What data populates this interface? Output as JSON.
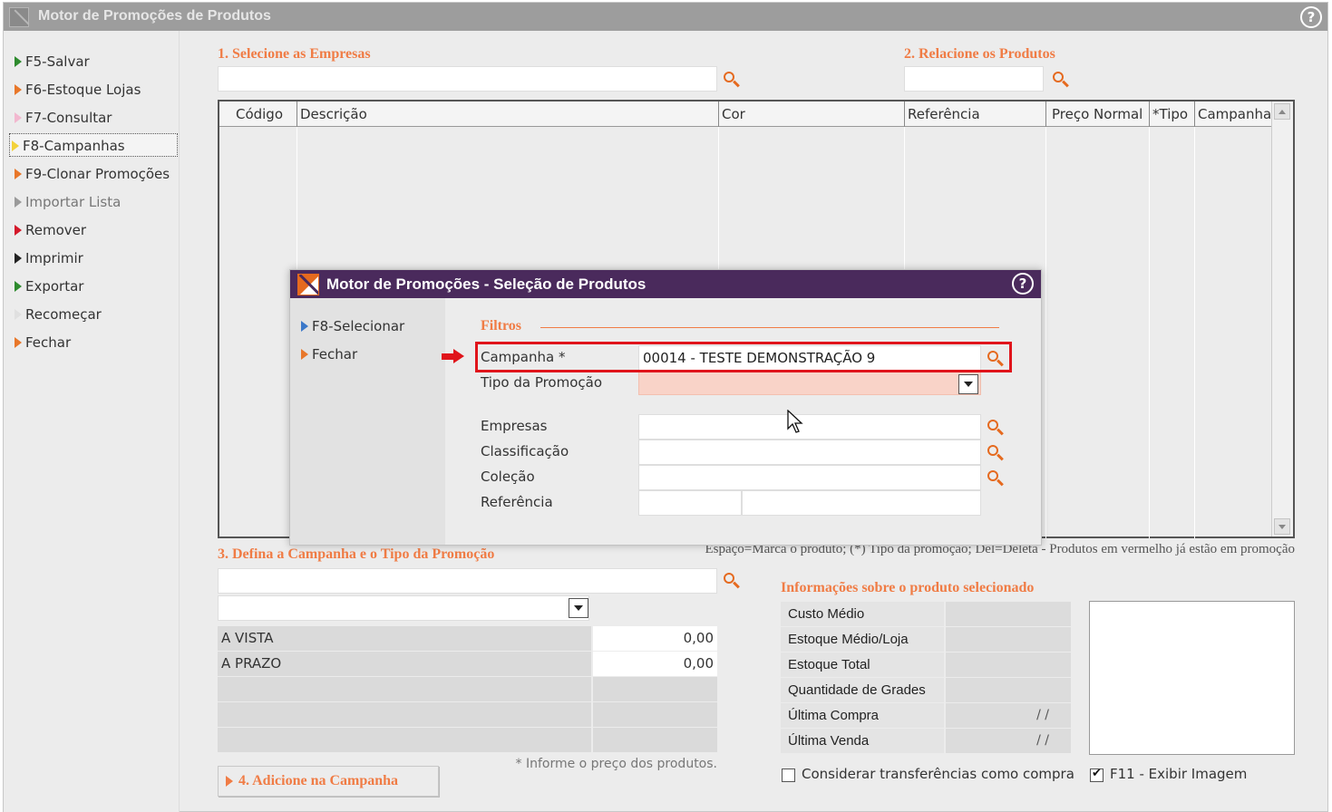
{
  "window": {
    "title": "Motor de Promoções de Produtos"
  },
  "sidebar": {
    "items": [
      {
        "label": "F5-Salvar",
        "color": "#2e8b2e"
      },
      {
        "label": "F6-Estoque Lojas",
        "color": "#e8772a"
      },
      {
        "label": "F7-Consultar",
        "color": "#f2b8cf"
      },
      {
        "label": "F8-Campanhas",
        "color": "#f3d23a"
      },
      {
        "label": "F9-Clonar Promoções",
        "color": "#e8772a"
      },
      {
        "label": "Importar Lista",
        "color": "#9a9a9a"
      },
      {
        "label": "Remover",
        "color": "#d4192b"
      },
      {
        "label": "Imprimir",
        "color": "#222222"
      },
      {
        "label": "Exportar",
        "color": "#2e8b2e"
      },
      {
        "label": "Recomeçar",
        "color": "#e0e0e0"
      },
      {
        "label": "Fechar",
        "color": "#e8772a"
      }
    ]
  },
  "section1": {
    "title": "1. Selecione as Empresas",
    "value": ""
  },
  "section2": {
    "title": "2. Relacione os Produtos",
    "value": ""
  },
  "grid": {
    "columns": [
      "Código",
      "Descrição",
      "Cor",
      "Referência",
      "Preço Normal",
      "*Tipo",
      "Campanha"
    ]
  },
  "legend": {
    "text": "Espaço=Marca o produto; (*) Tipo da promoção; Del=Deleta - Produtos em vermelho já estão em promoção"
  },
  "section3": {
    "title": "3. Defina a Campanha e o Tipo da Promoção",
    "campaign_value": "",
    "type_value": "",
    "prices": [
      {
        "label": "A VISTA",
        "value": "0,00"
      },
      {
        "label": "A PRAZO",
        "value": "0,00"
      }
    ],
    "note": "* Informe o preço dos produtos."
  },
  "section4": {
    "button_label": "4. Adicione na Campanha"
  },
  "info": {
    "title": "Informações sobre o produto selecionado",
    "rows": [
      {
        "label": "Custo Médio",
        "value": ""
      },
      {
        "label": "Estoque Médio/Loja",
        "value": ""
      },
      {
        "label": "Estoque Total",
        "value": ""
      },
      {
        "label": "Quantidade de Grades",
        "value": ""
      },
      {
        "label": "Última Compra",
        "value": "/ /"
      },
      {
        "label": "Última Venda",
        "value": "/ /"
      }
    ],
    "consider_transfers_label": "Considerar transferências como compra",
    "consider_transfers_checked": false,
    "show_image_label": "F11 - Exibir Imagem",
    "show_image_checked": true
  },
  "dialog": {
    "title": "Motor de Promoções - Seleção de Produtos",
    "side_items": [
      {
        "label": "F8-Selecionar",
        "color": "#3b78c9"
      },
      {
        "label": "Fechar",
        "color": "#e8772a"
      }
    ],
    "filters_title": "Filtros",
    "fields": {
      "campanha": {
        "label": "Campanha *",
        "value": "00014 - TESTE DEMONSTRAÇÃO 9"
      },
      "tipo": {
        "label": "Tipo da Promoção",
        "value": ""
      },
      "empresas": {
        "label": "Empresas",
        "value": ""
      },
      "classificacao": {
        "label": "Classificação",
        "value": ""
      },
      "colecao": {
        "label": "Coleção",
        "value": ""
      },
      "referencia": {
        "label": "Referência",
        "value": ""
      }
    }
  },
  "colors": {
    "accent_orange": "#f07c45",
    "dialog_titlebar": "#4a2a5c",
    "highlight_red": "#e0141b",
    "required_field_bg": "#f9d3c8"
  }
}
